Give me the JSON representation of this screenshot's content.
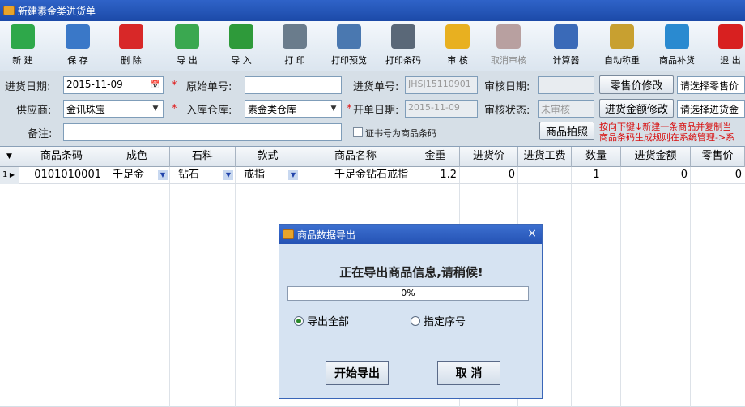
{
  "window": {
    "title": "新建素金类进货单",
    "icon": "app-icon"
  },
  "toolbar": {
    "buttons": [
      {
        "label": "新 建",
        "icon": "new-icon",
        "color": "#2ea84a",
        "enabled": true
      },
      {
        "label": "保 存",
        "icon": "save-icon",
        "color": "#3a78c8",
        "enabled": true
      },
      {
        "label": "删 除",
        "icon": "delete-icon",
        "color": "#d82828",
        "enabled": true
      },
      {
        "label": "导 出",
        "icon": "export-icon",
        "color": "#3aa850",
        "enabled": true
      },
      {
        "label": "导 入",
        "icon": "import-icon",
        "color": "#2e9a3a",
        "enabled": true
      },
      {
        "label": "打 印",
        "icon": "printer-icon",
        "color": "#6a7c8c",
        "enabled": true
      },
      {
        "label": "打印预览",
        "icon": "print-preview-icon",
        "color": "#4a78b0",
        "enabled": true
      },
      {
        "label": "打印条码",
        "icon": "barcode-printer-icon",
        "color": "#5a6878",
        "enabled": true
      },
      {
        "label": "审 核",
        "icon": "lock-icon",
        "color": "#e8b020",
        "enabled": true
      },
      {
        "label": "取消审核",
        "icon": "unlock-icon",
        "color": "#b8a0a0",
        "enabled": false
      },
      {
        "label": "计算器",
        "icon": "calculator-icon",
        "color": "#3a6ab8",
        "enabled": true
      },
      {
        "label": "自动称重",
        "icon": "scale-icon",
        "color": "#c8a030",
        "enabled": true
      },
      {
        "label": "商品补货",
        "icon": "bucket-icon",
        "color": "#2a8ad0",
        "enabled": true
      },
      {
        "label": "退 出",
        "icon": "exit-icon",
        "color": "#d82020",
        "enabled": true
      }
    ]
  },
  "form": {
    "purchase_date": {
      "label": "进货日期:",
      "value": "2015-11-09"
    },
    "original_no": {
      "label": "原始单号:",
      "value": ""
    },
    "purchase_no": {
      "label": "进货单号:",
      "value": "JHSJ15110901"
    },
    "audit_date": {
      "label": "审核日期:",
      "value": ""
    },
    "retail_price_btn": "零售价修改",
    "retail_select": "请选择零售价",
    "supplier": {
      "label": "供应商:",
      "value": "金讯珠宝"
    },
    "warehouse": {
      "label": "入库仓库:",
      "value": "素金类仓库"
    },
    "open_date": {
      "label": "开单日期:",
      "value": "2015-11-09"
    },
    "audit_status": {
      "label": "审核状态:",
      "value": "未审核"
    },
    "amount_btn": "进货金额修改",
    "amount_select": "请选择进货金",
    "remark": {
      "label": "备注:",
      "value": ""
    },
    "cert_checkbox": "证书号为商品条码",
    "photo_btn": "商品拍照",
    "hint_line1": "按向下键↓新建一条商品并复制当",
    "hint_line2": "商品条码生成规则在系统管理->系"
  },
  "grid": {
    "headers": [
      "商品条码",
      "成色",
      "石料",
      "款式",
      "商品名称",
      "金重",
      "进货价",
      "进货工费",
      "数量",
      "进货金额",
      "零售价"
    ],
    "rows": [
      {
        "index": "1",
        "barcode": "0101010001",
        "purity": "千足金",
        "stone": "钻石",
        "style": "戒指",
        "name": "千足金钻石戒指",
        "weight": "1.2",
        "cost_price": "0",
        "labor": "",
        "qty": "1",
        "amount": "0",
        "retail": "0"
      }
    ]
  },
  "dialog": {
    "title": "商品数据导出",
    "message": "正在导出商品信息,请稍候!",
    "progress": "0%",
    "progress_value": 0,
    "option_all": "导出全部",
    "option_index": "指定序号",
    "start_btn": "开始导出",
    "cancel_btn": "取 消"
  }
}
